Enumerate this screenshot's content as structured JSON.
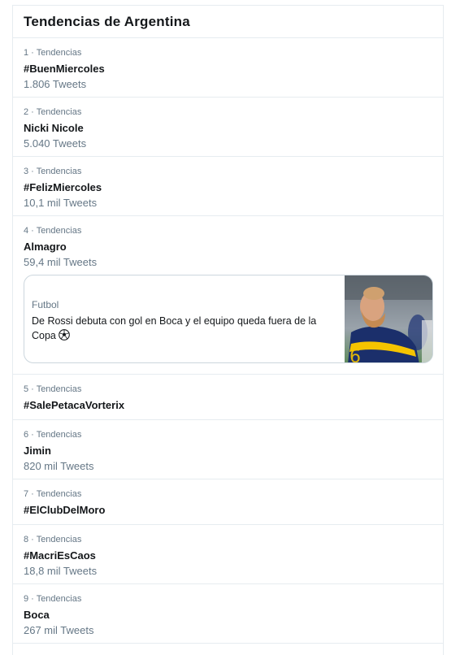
{
  "panel": {
    "title": "Tendencias de Argentina"
  },
  "trends": [
    {
      "meta": "1 · Tendencias",
      "name": "#BuenMiercoles",
      "count": "1.806 Tweets"
    },
    {
      "meta": "2 · Tendencias",
      "name": "Nicki Nicole",
      "count": "5.040 Tweets"
    },
    {
      "meta": "3 · Tendencias",
      "name": "#FelizMiercoles",
      "count": "10,1 mil Tweets"
    },
    {
      "meta": "4 · Tendencias",
      "name": "Almagro",
      "count": "59,4 mil Tweets"
    },
    {
      "meta": "5 · Tendencias",
      "name": "#SalePetacaVorterix",
      "count": ""
    },
    {
      "meta": "6 · Tendencias",
      "name": "Jimin",
      "count": "820 mil Tweets"
    },
    {
      "meta": "7 · Tendencias",
      "name": "#ElClubDelMoro",
      "count": ""
    },
    {
      "meta": "8 · Tendencias",
      "name": "#MacriEsCaos",
      "count": "18,8 mil Tweets"
    },
    {
      "meta": "9 · Tendencias",
      "name": "Boca",
      "count": "267 mil Tweets"
    }
  ],
  "news": {
    "category": "Futbol",
    "headline": "De Rossi debuta con gol en Boca y el equipo queda fuera de la Copa",
    "emoji_icon": "soccer-ball-icon"
  },
  "colors": {
    "text": "#14171a",
    "muted": "#657786",
    "border": "#e6ecf0",
    "boca_blue": "#1b2f6b",
    "boca_gold": "#f5c400"
  }
}
